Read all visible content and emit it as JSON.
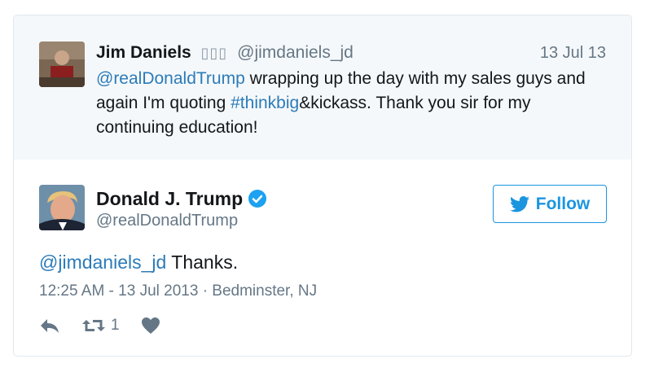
{
  "quoted_tweet": {
    "author_name": "Jim Daniels",
    "author_emoji": "▯▯▯",
    "author_handle": "@jimdaniels_jd",
    "date": "13 Jul 13",
    "mention": "@realDonaldTrump",
    "text_part1": " wrapping up the day with my sales guys and again I'm quoting ",
    "hashtag": "#thinkbig",
    "text_part2": "&kickass. Thank you sir for my continuing education!"
  },
  "tweet": {
    "author_name": "Donald J. Trump",
    "author_handle": "@realDonaldTrump",
    "follow_label": "Follow",
    "mention": "@jimdaniels_jd",
    "text": " Thanks.",
    "meta": "12:25 AM - 13 Jul 2013 · Bedminster, NJ",
    "retweet_count": "1"
  },
  "colors": {
    "link": "#2b7bb9",
    "follow": "#1b95e0",
    "muted": "#657786",
    "quoted_bg": "#f5f8fa"
  },
  "icons": [
    "reply-icon",
    "retweet-icon",
    "like-icon",
    "twitter-bird-icon",
    "verified-badge-icon"
  ]
}
